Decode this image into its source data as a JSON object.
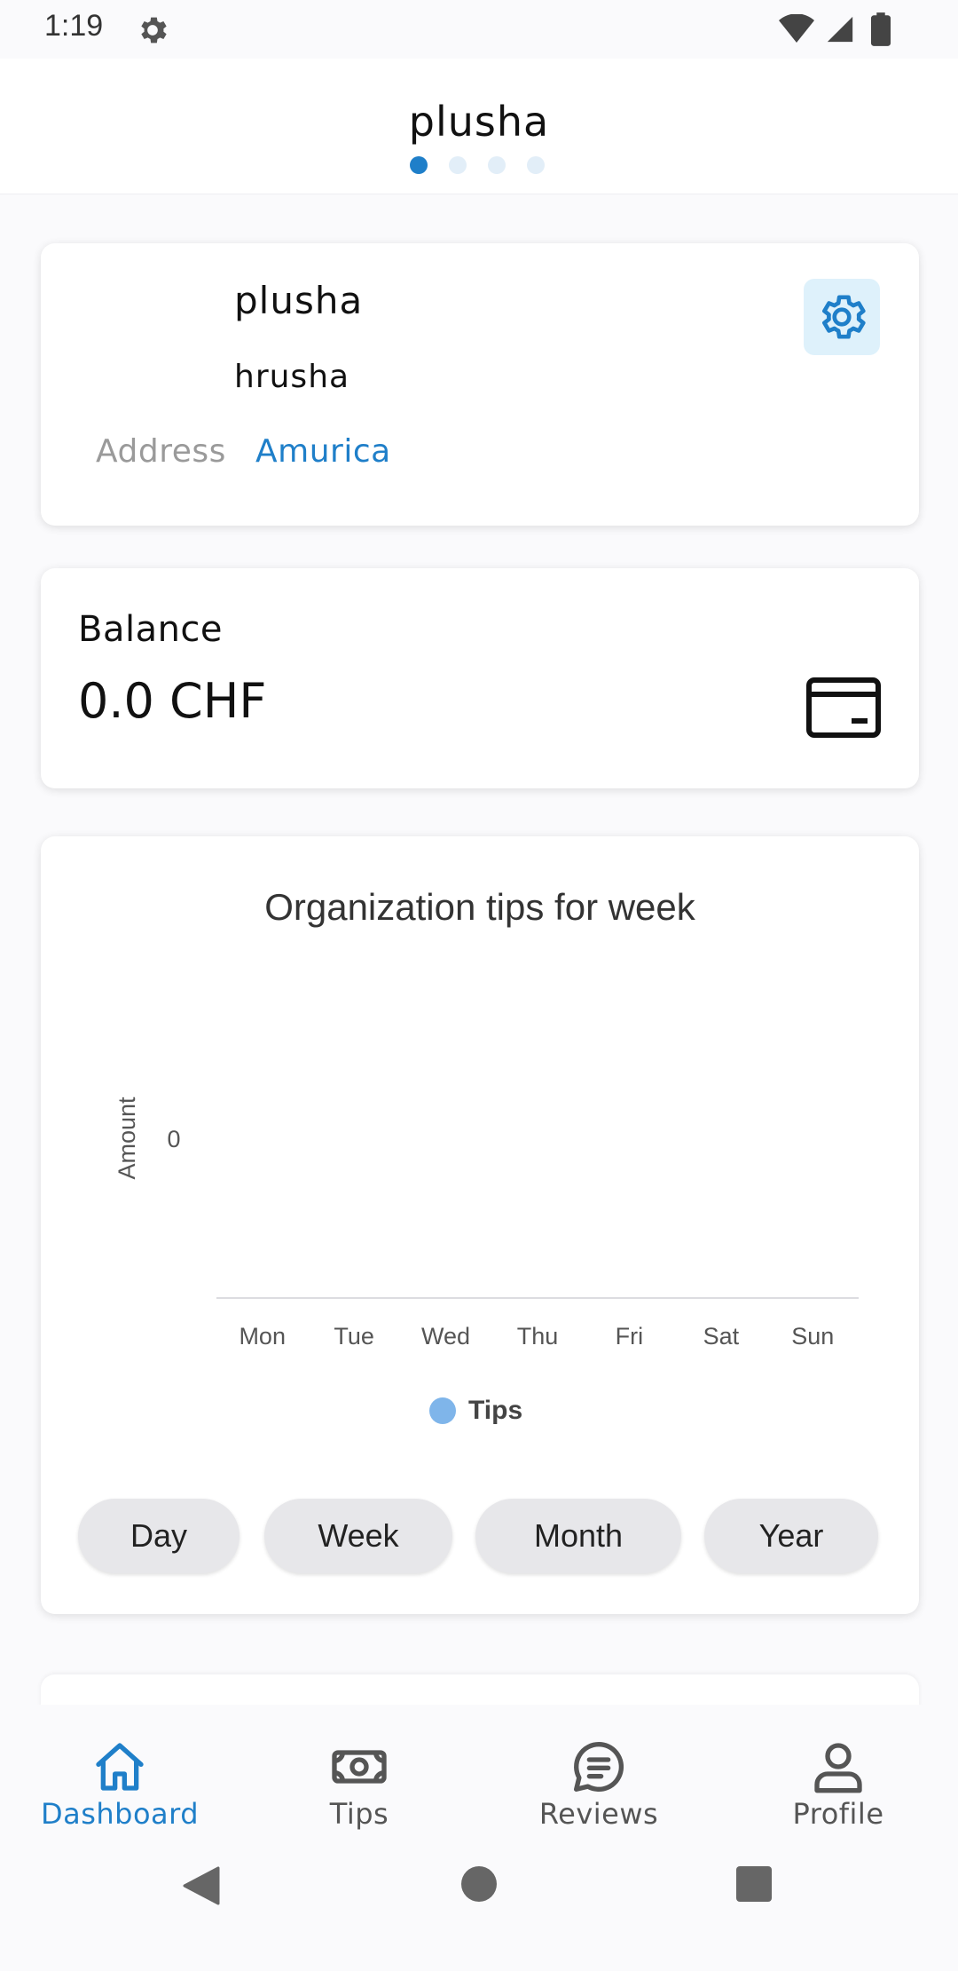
{
  "status_bar": {
    "time": "1:19",
    "icons": [
      "settings-icon",
      "wifi-icon",
      "signal-icon",
      "battery-icon"
    ]
  },
  "app_bar": {
    "title": "plusha",
    "page_indicator": {
      "count": 4,
      "active_index": 0
    }
  },
  "profile": {
    "name": "plusha",
    "username": "hrusha",
    "address_label": "Address",
    "address_value": "Amurica",
    "settings_icon": "gear-icon"
  },
  "balance": {
    "label": "Balance",
    "amount": "0.0 CHF",
    "icon": "wallet-icon"
  },
  "chart_card": {
    "title": "Organization tips for week",
    "legend_label": "Tips",
    "range_buttons": [
      "Day",
      "Week",
      "Month",
      "Year"
    ]
  },
  "chart_data": {
    "type": "bar",
    "title": "Organization tips for week",
    "xlabel": "",
    "ylabel": "Amount",
    "categories": [
      "Mon",
      "Tue",
      "Wed",
      "Thu",
      "Fri",
      "Sat",
      "Sun"
    ],
    "y_ticks": [
      "0"
    ],
    "series": [
      {
        "name": "Tips",
        "values": [
          0,
          0,
          0,
          0,
          0,
          0,
          0
        ]
      }
    ],
    "legend_position": "bottom"
  },
  "bottom_nav": {
    "items": [
      {
        "label": "Dashboard",
        "icon": "home-icon",
        "active": true
      },
      {
        "label": "Tips",
        "icon": "banknote-icon",
        "active": false
      },
      {
        "label": "Reviews",
        "icon": "chat-bubble-icon",
        "active": false
      },
      {
        "label": "Profile",
        "icon": "user-icon",
        "active": false
      }
    ]
  },
  "colors": {
    "accent": "#1f7fc9",
    "inactive": "#555555",
    "legend_dot": "#7fb5ea",
    "settings_bg": "#def1fb"
  }
}
